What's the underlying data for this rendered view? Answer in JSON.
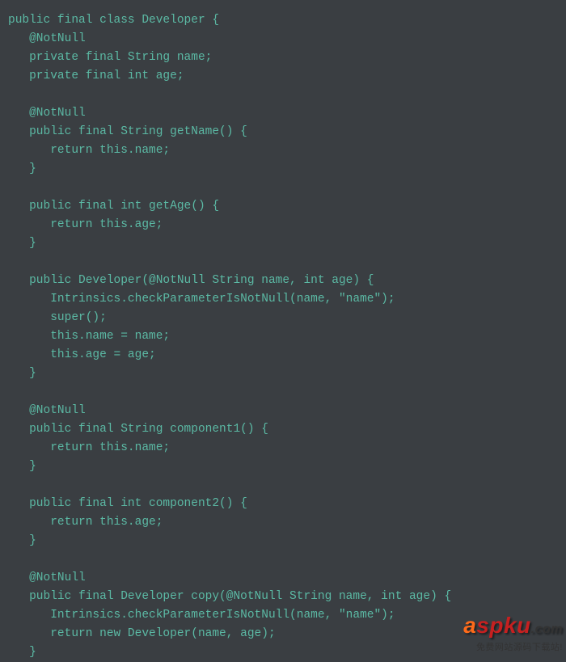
{
  "code": {
    "lines": [
      "public final class Developer {",
      "   @NotNull",
      "   private final String name;",
      "   private final int age;",
      "",
      "   @NotNull",
      "   public final String getName() {",
      "      return this.name;",
      "   }",
      "",
      "   public final int getAge() {",
      "      return this.age;",
      "   }",
      "",
      "   public Developer(@NotNull String name, int age) {",
      "      Intrinsics.checkParameterIsNotNull(name, \"name\");",
      "      super();",
      "      this.name = name;",
      "      this.age = age;",
      "   }",
      "",
      "   @NotNull",
      "   public final String component1() {",
      "      return this.name;",
      "   }",
      "",
      "   public final int component2() {",
      "      return this.age;",
      "   }",
      "",
      "   @NotNull",
      "   public final Developer copy(@NotNull String name, int age) {",
      "      Intrinsics.checkParameterIsNotNull(name, \"name\");",
      "      return new Developer(name, age);",
      "   }"
    ]
  },
  "watermark": {
    "brand_a": "a",
    "brand_spku": "spku",
    "brand_com": ".com",
    "tagline": "免费网站源码下载站!"
  }
}
